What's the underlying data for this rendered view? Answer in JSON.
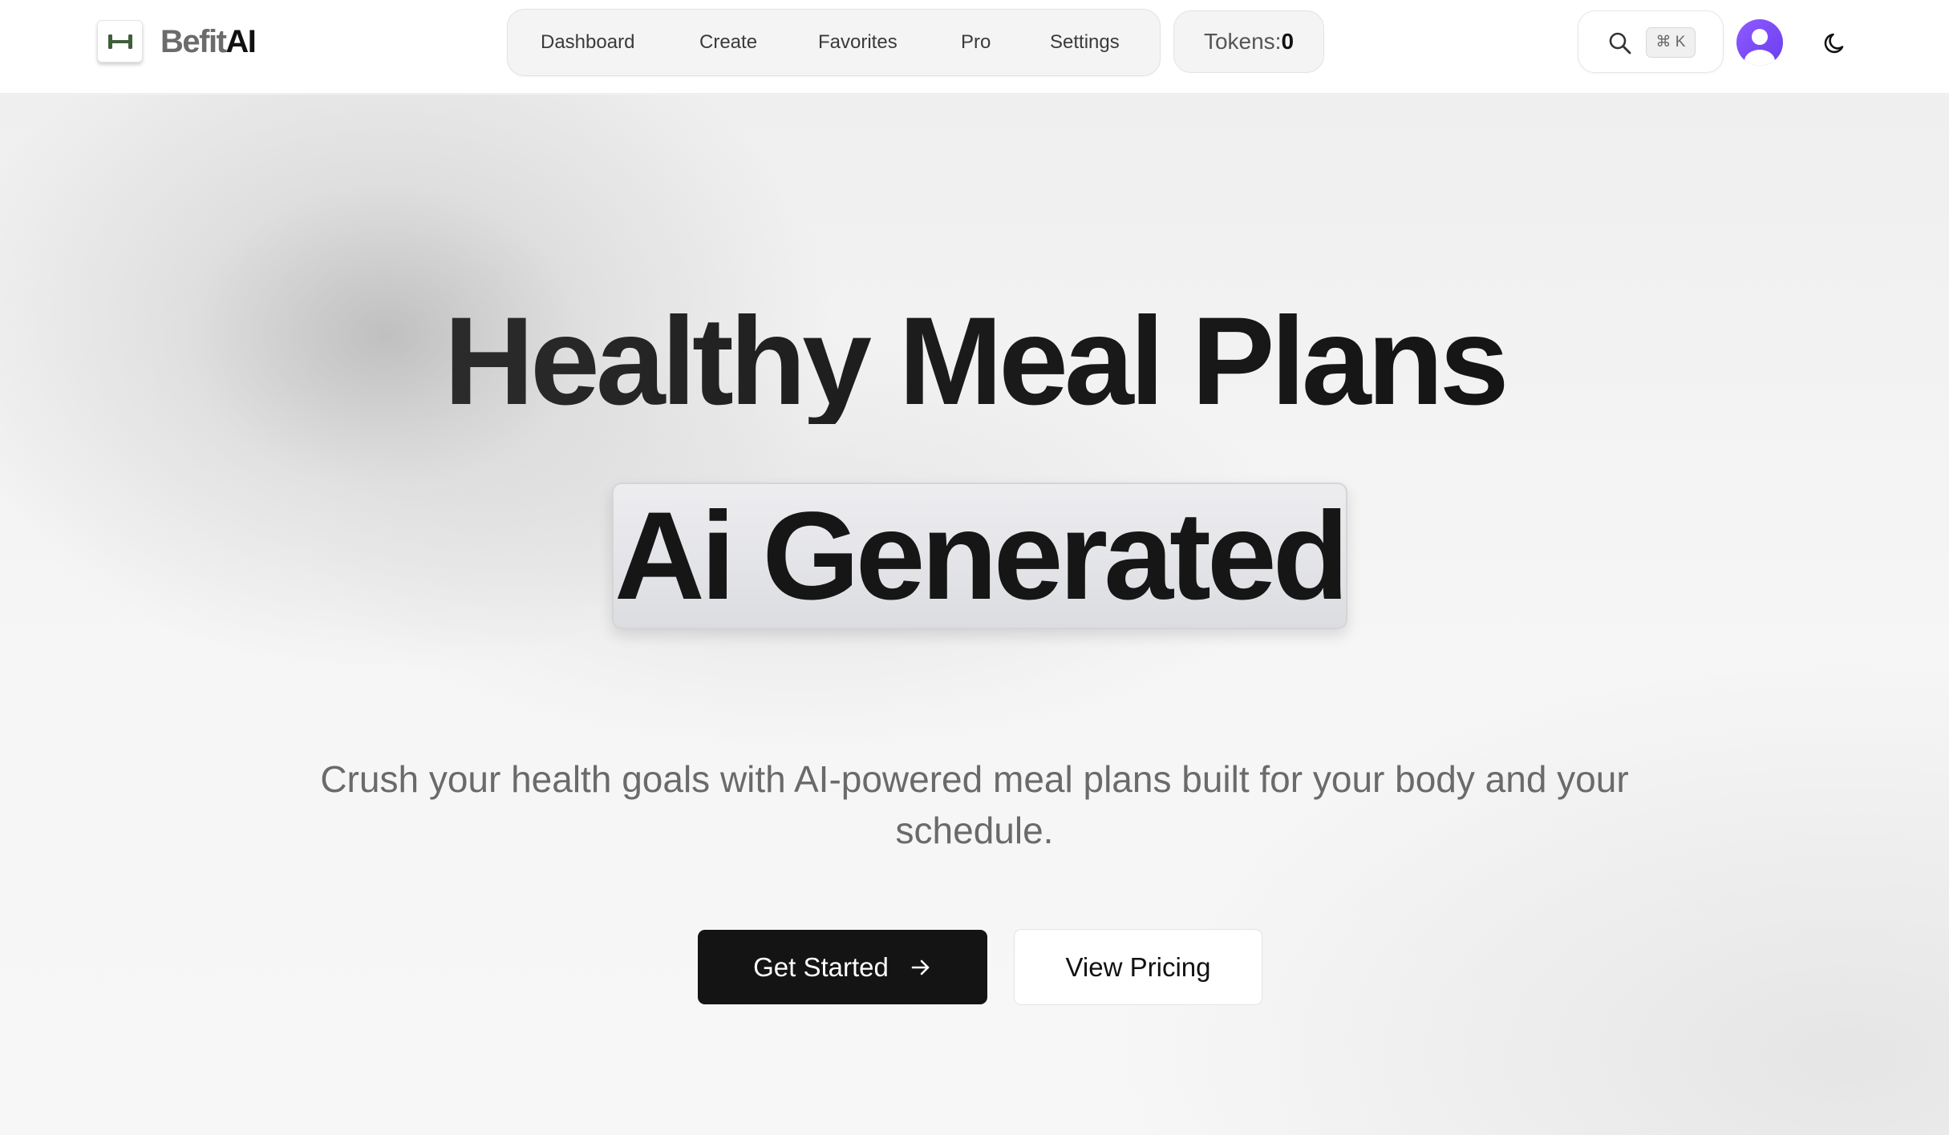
{
  "brand": {
    "name_part1": "Befit",
    "name_part2": "AI"
  },
  "nav": {
    "items": [
      {
        "label": "Dashboard"
      },
      {
        "label": "Create"
      },
      {
        "label": "Favorites"
      },
      {
        "label": "Pro"
      },
      {
        "label": "Settings"
      }
    ]
  },
  "tokens": {
    "label": "Tokens:",
    "value": "0"
  },
  "search": {
    "shortcut": "⌘ K"
  },
  "hero": {
    "title_line1": "Healthy Meal Plans",
    "title_line2": "Ai Generated",
    "subtitle": "Crush your health goals with AI-powered meal plans built for your body and your schedule.",
    "primary_button": "Get Started",
    "secondary_button": "View Pricing"
  },
  "icons": {
    "logo": "dumbbell-icon",
    "search": "search-icon",
    "avatar": "user-avatar-icon",
    "theme": "moon-icon",
    "arrow": "arrow-right-icon"
  },
  "colors": {
    "brand_logo_green": "#3f5e3a",
    "avatar_purple": "#7b4dff",
    "primary_button_bg": "#141414"
  }
}
